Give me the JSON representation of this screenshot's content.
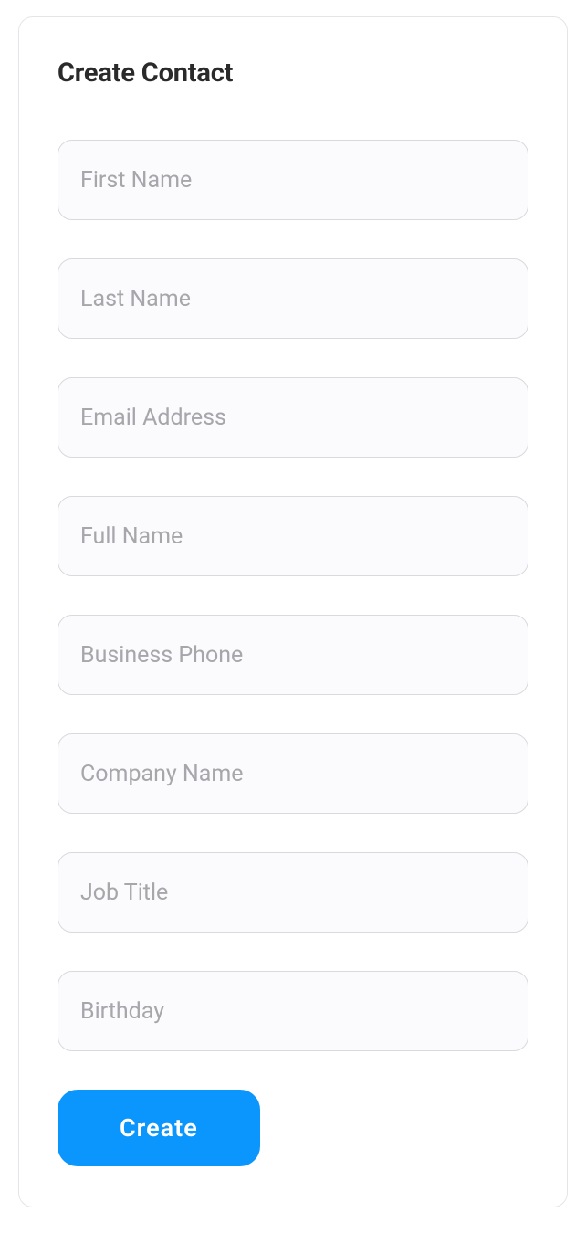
{
  "form": {
    "title": "Create Contact",
    "fields": {
      "first_name": {
        "placeholder": "First Name",
        "value": ""
      },
      "last_name": {
        "placeholder": "Last Name",
        "value": ""
      },
      "email": {
        "placeholder": "Email Address",
        "value": ""
      },
      "full_name": {
        "placeholder": "Full Name",
        "value": ""
      },
      "business_phone": {
        "placeholder": "Business Phone",
        "value": ""
      },
      "company_name": {
        "placeholder": "Company Name",
        "value": ""
      },
      "job_title": {
        "placeholder": "Job Title",
        "value": ""
      },
      "birthday": {
        "placeholder": "Birthday",
        "value": ""
      }
    },
    "submit_label": "Create"
  }
}
